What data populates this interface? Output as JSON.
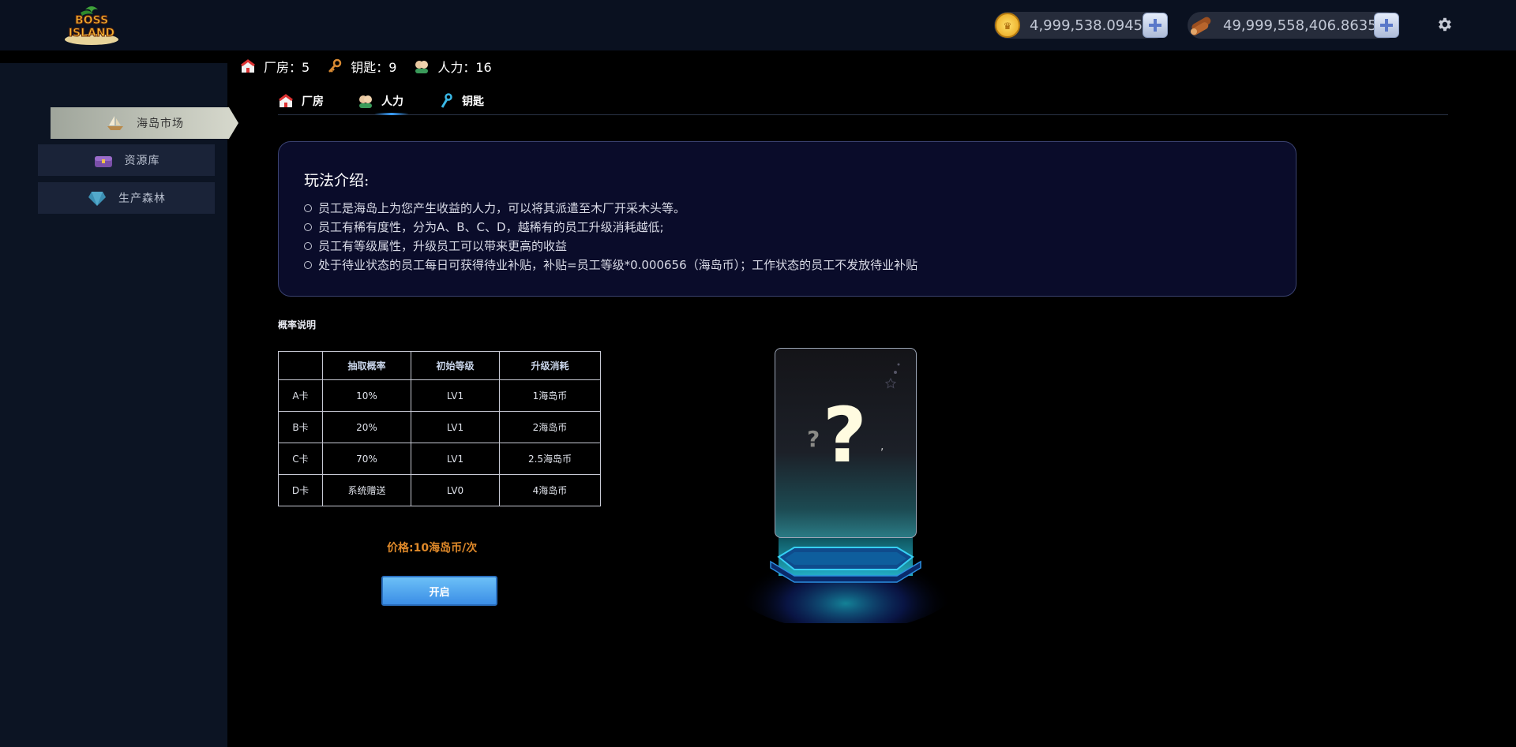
{
  "header": {
    "logo_text_1": "BOSS",
    "logo_text_2": "ISLAND",
    "currency_coin": "4,999,538.0945",
    "currency_wood": "49,999,558,406.8635",
    "icons": {
      "coin": "coin-icon",
      "wood": "wood-icon",
      "plus": "plus-icon",
      "settings": "gear-icon"
    }
  },
  "sidebar": {
    "items": [
      {
        "label": "海岛市场",
        "icon": "boat-icon",
        "active": true
      },
      {
        "label": "资源库",
        "icon": "chest-icon",
        "active": false
      },
      {
        "label": "生产森林",
        "icon": "gem-icon",
        "active": false
      }
    ]
  },
  "stats": {
    "factory": "厂房：5",
    "key": "钥匙：9",
    "labor": "人力：16"
  },
  "tabs": [
    {
      "label": "厂房",
      "icon": "factory-icon"
    },
    {
      "label": "人力",
      "icon": "worker-icon",
      "active": true
    },
    {
      "label": "钥匙",
      "icon": "key-icon"
    }
  ],
  "intro": {
    "title": "玩法介绍:",
    "lines": [
      "员工是海岛上为您产生收益的人力，可以将其派遣至木厂开采木头等。",
      "员工有稀有度性，分为A、B、C、D，越稀有的员工升级消耗越低;",
      "员工有等级属性，升级员工可以带来更高的收益",
      "处于待业状态的员工每日可获得待业补贴，补贴=员工等级*0.000656（海岛币）；工作状态的员工不发放待业补贴"
    ]
  },
  "probability": {
    "title": "概率说明",
    "headers": [
      "",
      "抽取概率",
      "初始等级",
      "升级消耗"
    ],
    "rows": [
      [
        "A卡",
        "10%",
        "LV1",
        "1海岛币"
      ],
      [
        "B卡",
        "20%",
        "LV1",
        "2海岛币"
      ],
      [
        "C卡",
        "70%",
        "LV1",
        "2.5海岛币"
      ],
      [
        "D卡",
        "系统赠送",
        "LV0",
        "4海岛币"
      ]
    ]
  },
  "purchase": {
    "price": "价格:10海岛币/次",
    "button": "开启"
  },
  "card": {
    "symbol": "?"
  },
  "colors": {
    "accent_blue": "#3b8ee6",
    "price_orange": "#e08a2a",
    "panel_bg": "#0a0c2a"
  }
}
